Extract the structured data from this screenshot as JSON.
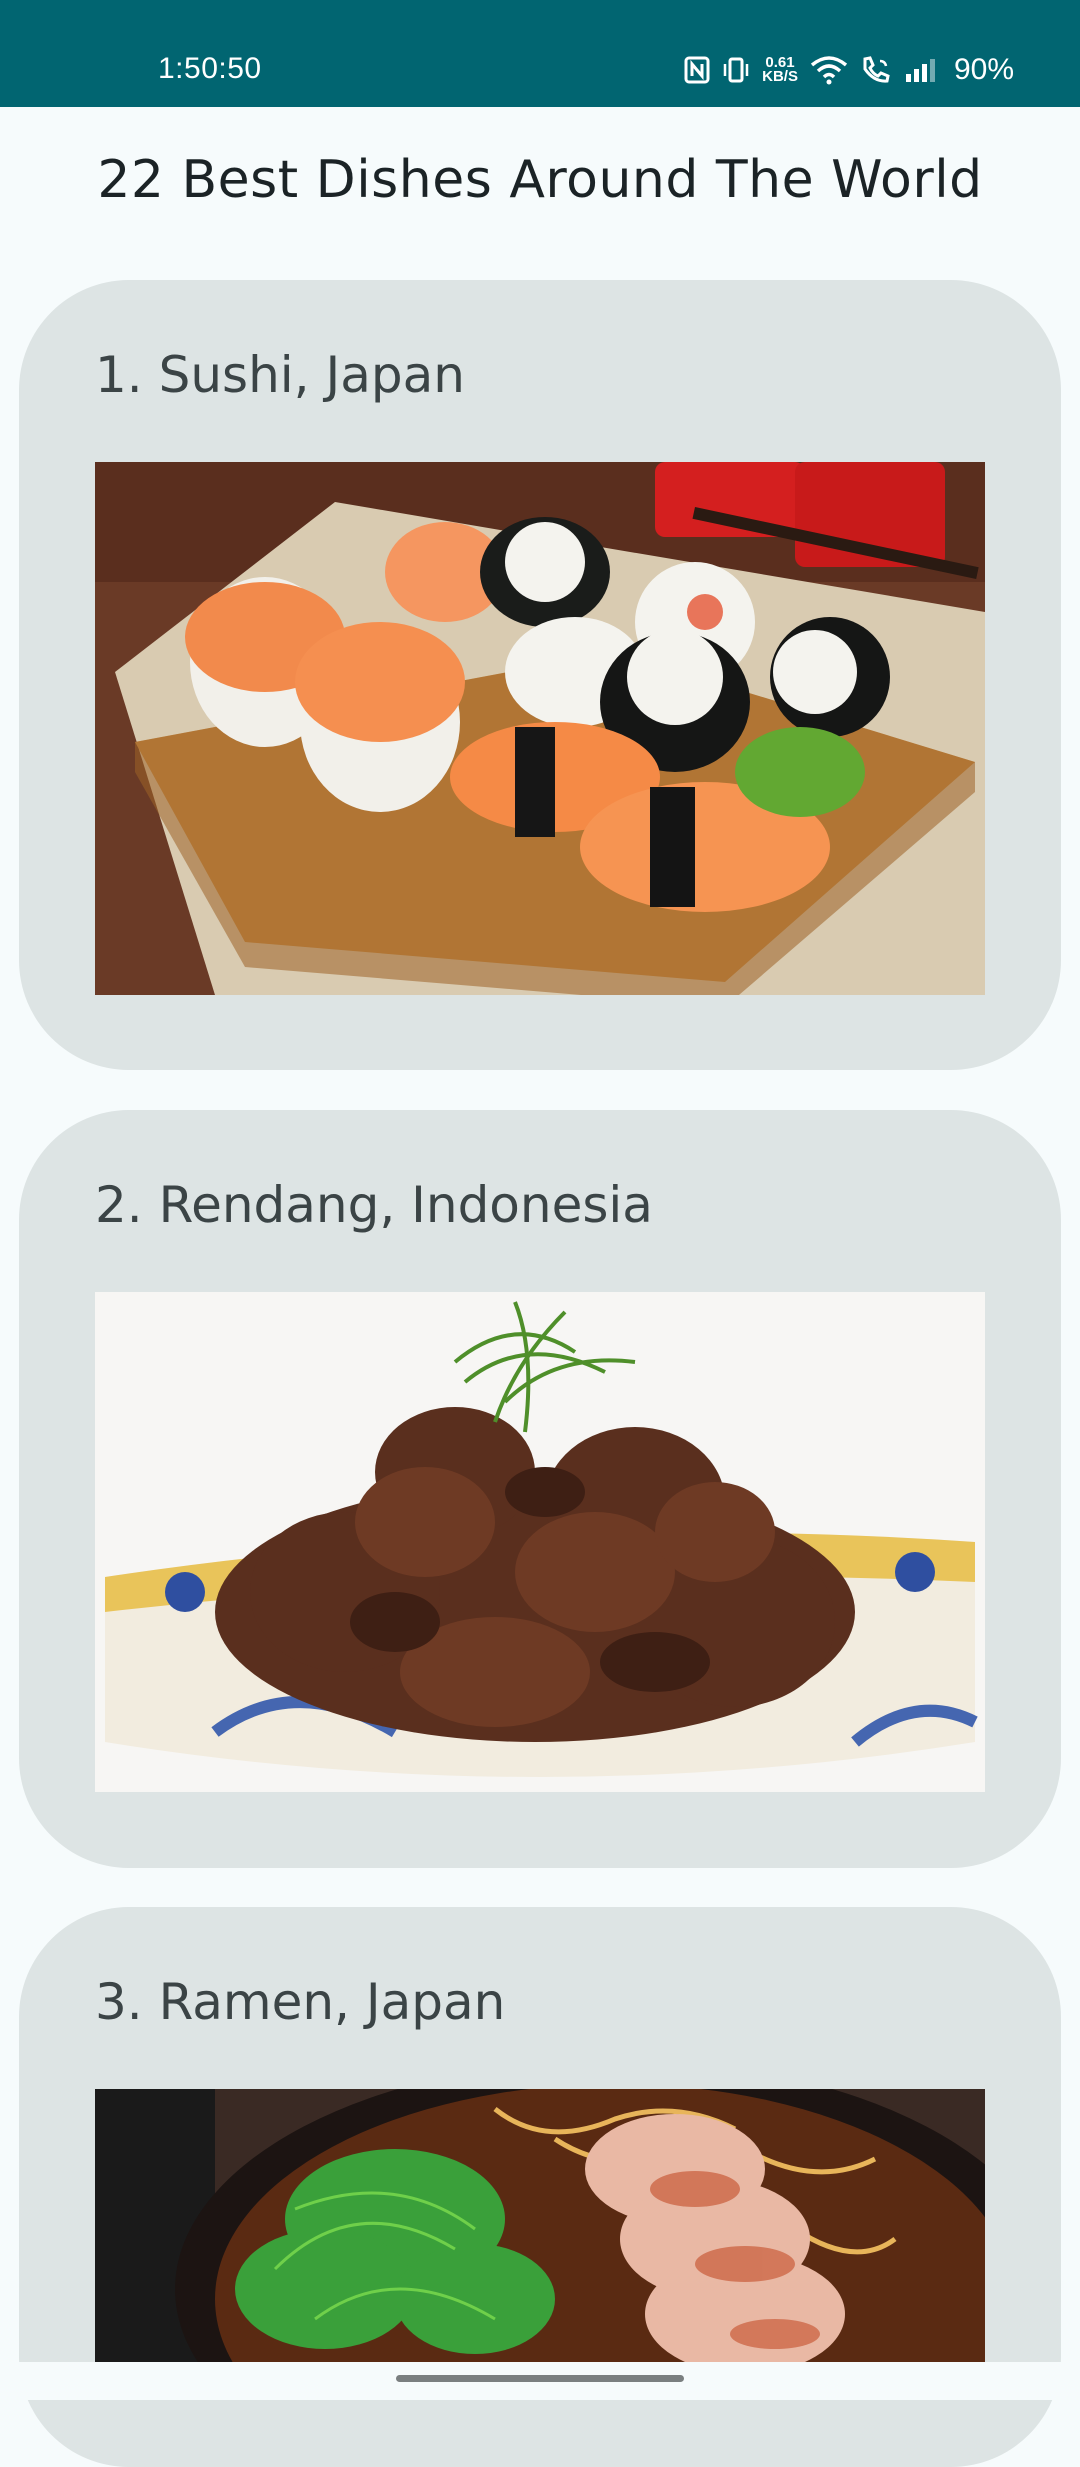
{
  "status_bar": {
    "time": "1:50:50",
    "net_speed_value": "0.61",
    "net_speed_unit": "KB/S",
    "battery": "90%",
    "icons": [
      "nfc-icon",
      "vibrate-icon",
      "wifi-icon",
      "wifi-calling-icon",
      "signal-icon"
    ]
  },
  "page": {
    "title": "22 Best Dishes Around The World"
  },
  "dishes": [
    {
      "title": "1. Sushi, Japan",
      "image": "sushi-photo"
    },
    {
      "title": "2. Rendang, Indonesia",
      "image": "rendang-photo"
    },
    {
      "title": "3. Ramen, Japan",
      "image": "ramen-photo"
    }
  ],
  "colors": {
    "status_bar": "#016571",
    "background": "#f6fbfc",
    "card": "#dde4e4",
    "title_text": "#1b2326",
    "card_text": "#3b4446"
  }
}
